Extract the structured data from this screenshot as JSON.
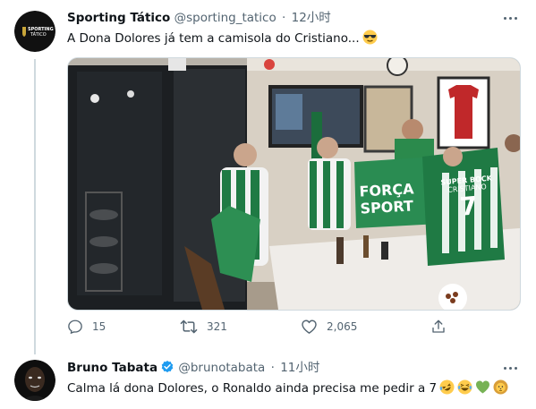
{
  "tweet1": {
    "display_name": "Sporting Tático",
    "handle": "@sporting_tatico",
    "separator": "·",
    "time": "12小时",
    "text": "A Dona Dolores já tem a camisola do Cristiano...",
    "emoji_icon": "smiling-face-with-sunglasses",
    "media_labels": {
      "flag_line1": "FORÇA",
      "flag_line2": "SPORT",
      "shirt_name_1": "SUPER BOCK",
      "shirt_name_2": "CRISTIANO",
      "shirt_number": "7"
    },
    "actions": {
      "reply_count": "15",
      "retweet_count": "321",
      "like_count": "2,065"
    }
  },
  "tweet2": {
    "display_name": "Bruno Tabata",
    "handle": "@brunotabata",
    "separator": "·",
    "time": "11小时",
    "text": "Calma lá dona Dolores, o Ronaldo ainda precisa me pedir a 7",
    "emoji_icons": [
      "rolling-on-floor-laughing",
      "grinning-squinting-face",
      "green-heart",
      "lion-face"
    ]
  },
  "colors": {
    "secondary_text": "#536471",
    "verified_blue": "#1d9bf0",
    "sporting_green": "#1f7a44"
  }
}
